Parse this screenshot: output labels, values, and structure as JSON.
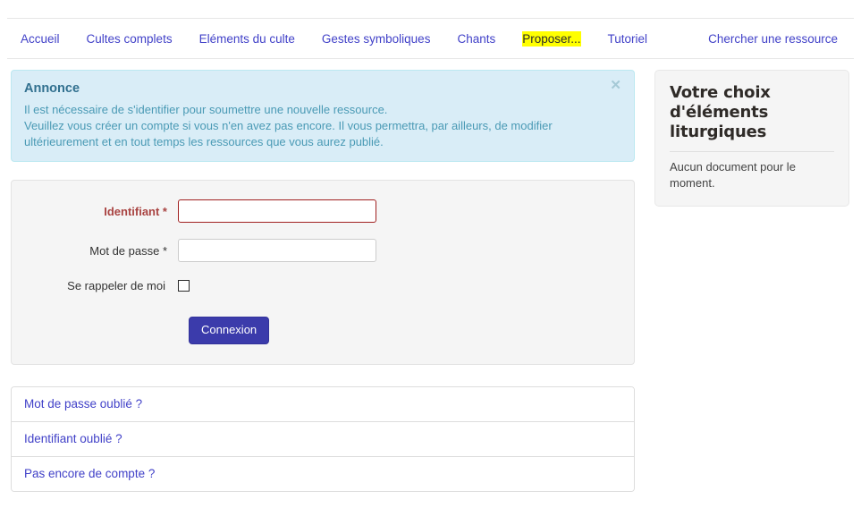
{
  "nav": {
    "items": [
      {
        "label": "Accueil",
        "highlighted": false
      },
      {
        "label": "Cultes complets",
        "highlighted": false
      },
      {
        "label": "Eléments du culte",
        "highlighted": false
      },
      {
        "label": "Gestes symboliques",
        "highlighted": false
      },
      {
        "label": "Chants",
        "highlighted": false
      },
      {
        "label": "Proposer...",
        "highlighted": true
      },
      {
        "label": "Tutoriel",
        "highlighted": false
      }
    ],
    "right_item": {
      "label": "Chercher une ressource"
    },
    "link_color": "#4141c8",
    "highlight_color": "#ffff00"
  },
  "alert": {
    "title": "Annonce",
    "line1": "Il est nécessaire de s'identifier pour soumettre une nouvelle ressource.",
    "line2": "Veuillez vous créer un compte si vous n'en avez pas encore. Il vous permettra, par ailleurs, de modifier",
    "line3": "ultérieurement et en tout temps les ressources que vous aurez publié.",
    "close_icon": "close-icon",
    "close_glyph": "✕",
    "background_color": "#d9edf7",
    "border_color": "#bce8f1",
    "text_color": "#31708f"
  },
  "login_form": {
    "username": {
      "label": "Identifiant *",
      "value": "",
      "placeholder": "",
      "error": true,
      "error_color": "#a94442"
    },
    "password": {
      "label": "Mot de passe *",
      "value": "",
      "placeholder": "",
      "error": false
    },
    "remember": {
      "label": "Se rappeler de moi",
      "checked": false
    },
    "submit_label": "Connexion",
    "submit_color": "#3b3bab"
  },
  "help_links": [
    {
      "label": "Mot de passe oublié ?"
    },
    {
      "label": "Identifiant oublié ?"
    },
    {
      "label": "Pas encore de compte ?"
    }
  ],
  "sidebar_card": {
    "title": "Votre choix d'éléments liturgiques",
    "body": "Aucun document pour le moment.",
    "background_color": "#f5f5f5"
  }
}
